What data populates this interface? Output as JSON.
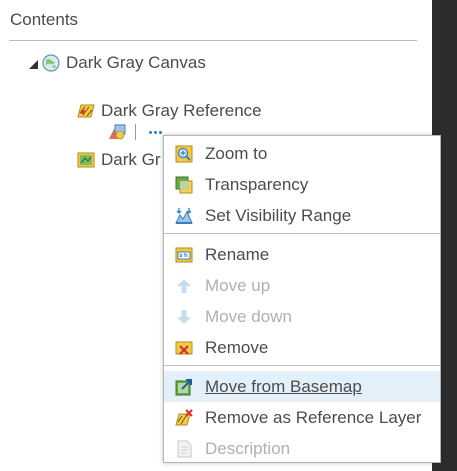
{
  "panel": {
    "title": "Contents"
  },
  "tree": {
    "basemap": {
      "label": "Dark Gray Canvas",
      "icon": "basemap-globe-icon"
    },
    "reference_layer": {
      "label": "Dark Gray Reference",
      "icon": "reference-layer-icon",
      "legend_icon": "legend-swatch-icon",
      "more_icon": "more-options-icon"
    },
    "basemap_layer": {
      "label": "Dark Gr",
      "icon": "basemap-layer-icon"
    }
  },
  "context_menu": {
    "items": [
      {
        "label": "Zoom to",
        "icon": "zoom-to-icon",
        "enabled": true
      },
      {
        "label": "Transparency",
        "icon": "transparency-icon",
        "enabled": true
      },
      {
        "label": "Set Visibility Range",
        "icon": "visibility-range-icon",
        "enabled": true
      },
      {
        "label": "Rename",
        "icon": "rename-icon",
        "enabled": true
      },
      {
        "label": "Move up",
        "icon": "arrow-up-icon",
        "enabled": false
      },
      {
        "label": "Move down",
        "icon": "arrow-down-icon",
        "enabled": false
      },
      {
        "label": "Remove",
        "icon": "remove-icon",
        "enabled": true
      },
      {
        "label": "Move from Basemap",
        "icon": "move-from-basemap-icon",
        "enabled": true,
        "hovered": true
      },
      {
        "label": "Remove as Reference Layer",
        "icon": "remove-reference-icon",
        "enabled": true
      },
      {
        "label": "Description",
        "icon": "description-icon",
        "enabled": false
      }
    ]
  },
  "colors": {
    "accent": "#2f7ec6",
    "hover_bg": "#e3f0fa",
    "text": "#4c4c4c",
    "disabled_text": "#b0b0b0",
    "dark_panel": "#2d2d2d"
  }
}
